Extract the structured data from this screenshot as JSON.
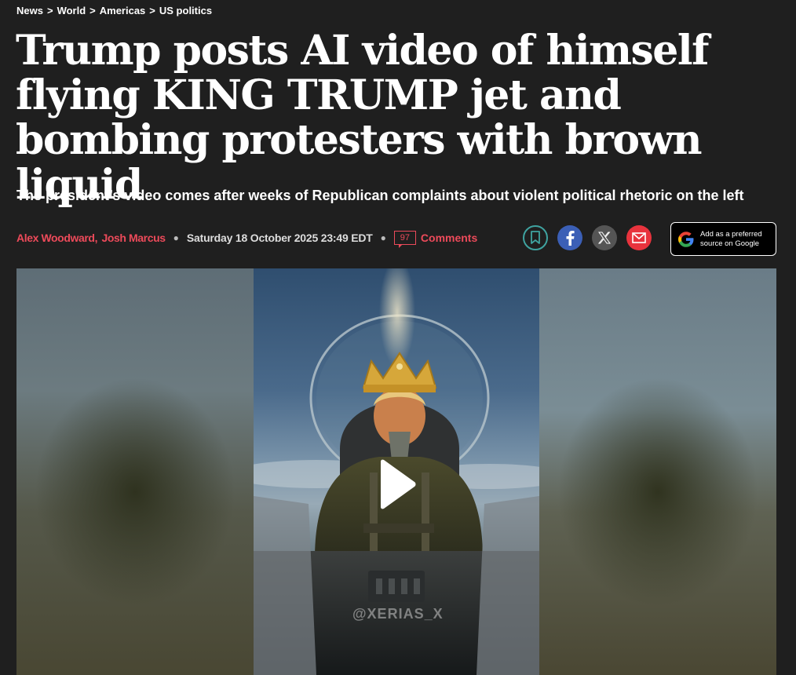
{
  "breadcrumb": {
    "items": [
      "News",
      "World",
      "Americas",
      "US politics"
    ],
    "separator": ">"
  },
  "headline": "Trump posts AI video of himself flying KING TRUMP jet and bombing protesters with brown liquid",
  "standfirst": "The president’s video comes after weeks of Republican complaints about violent political rhetoric on the left",
  "byline": {
    "authors": [
      "Alex Woodward",
      "Josh Marcus"
    ],
    "date": "Saturday 18 October 2025 23:49 EDT",
    "comment_count": "97",
    "comments_label": "Comments"
  },
  "share": {
    "icons": [
      "bookmark-icon",
      "facebook-icon",
      "x-icon",
      "email-icon"
    ]
  },
  "google_pref": {
    "line1": "Add as a preferred",
    "line2": "source on Google"
  },
  "video": {
    "watermark": "@XERIAS_X"
  },
  "colors": {
    "background": "#1f1f1f",
    "accent_red": "#ec4a5a",
    "bookmark_teal": "#3fa3a0",
    "facebook_blue": "#3b5fb6",
    "email_red": "#e8333d"
  }
}
